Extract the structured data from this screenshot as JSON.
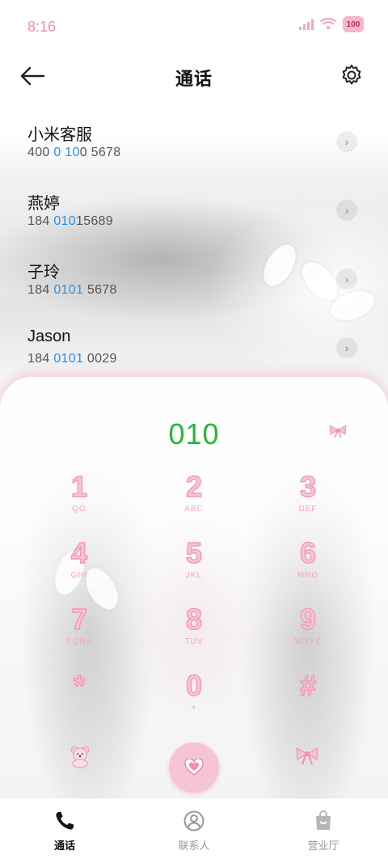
{
  "status": {
    "time": "8:16",
    "battery": "100"
  },
  "header": {
    "title": "通话"
  },
  "results": [
    {
      "name": "小米客服",
      "number_pre": "400 ",
      "number_hl": "0 10",
      "number_post": "0 5678"
    },
    {
      "name": "燕婷",
      "number_pre": "184 ",
      "number_hl": "010",
      "number_post": "15689"
    },
    {
      "name": "子玲",
      "number_pre": "184 ",
      "number_hl": "0101",
      "number_post": " 5678"
    },
    {
      "name": "Jason",
      "number_pre": "184 ",
      "number_hl": "0101",
      "number_post": " 0029"
    }
  ],
  "dialer": {
    "display": "010",
    "keys": [
      {
        "digit": "1",
        "letters": "QO"
      },
      {
        "digit": "2",
        "letters": "ABC"
      },
      {
        "digit": "3",
        "letters": "DEF"
      },
      {
        "digit": "4",
        "letters": "GHI"
      },
      {
        "digit": "5",
        "letters": "JKL"
      },
      {
        "digit": "6",
        "letters": "MNO"
      },
      {
        "digit": "7",
        "letters": "PQRS"
      },
      {
        "digit": "8",
        "letters": "TUV"
      },
      {
        "digit": "9",
        "letters": "WXYZ"
      },
      {
        "digit": "*",
        "letters": ","
      },
      {
        "digit": "0",
        "letters": "+"
      },
      {
        "digit": "#",
        "letters": ""
      }
    ]
  },
  "nav": [
    {
      "label": "通话",
      "icon": "phone-icon",
      "active": true
    },
    {
      "label": "联系人",
      "icon": "contacts-icon",
      "active": false
    },
    {
      "label": "营业厅",
      "icon": "store-bag-icon",
      "active": false
    }
  ],
  "colors": {
    "accent_pink": "#f29ab7",
    "match_blue": "#2a92e8",
    "display_green": "#24b935"
  }
}
